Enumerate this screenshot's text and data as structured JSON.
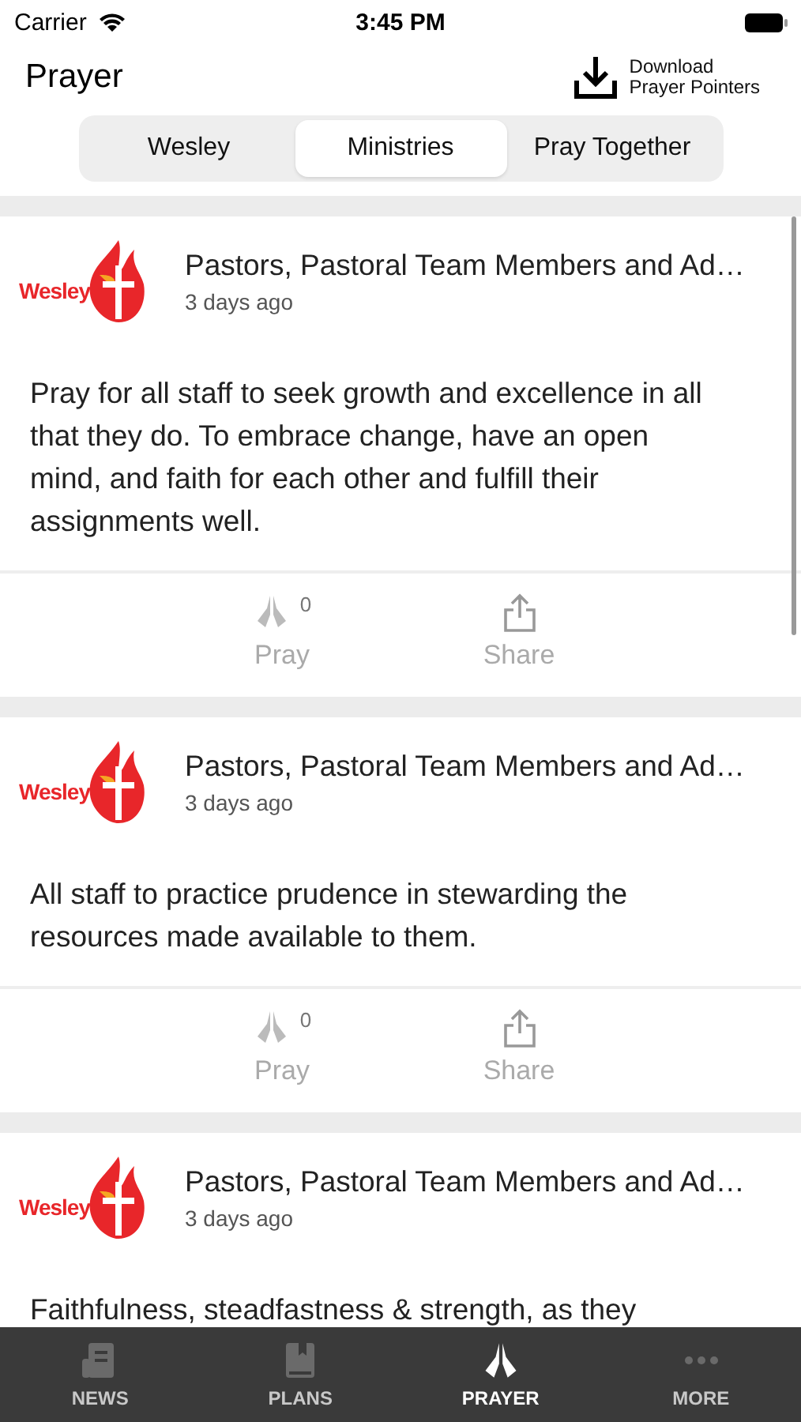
{
  "status_bar": {
    "carrier": "Carrier",
    "time": "3:45 PM"
  },
  "header": {
    "title": "Prayer",
    "download": {
      "line1": "Download",
      "line2": "Prayer Pointers"
    }
  },
  "tabs": [
    {
      "label": "Wesley",
      "selected": false
    },
    {
      "label": "Ministries",
      "selected": true
    },
    {
      "label": "Pray Together",
      "selected": false
    }
  ],
  "posts": [
    {
      "logo_text": "Wesley",
      "title": "Pastors, Pastoral Team Members and Ad…",
      "time": "3 days ago",
      "body": "Pray for all staff to seek growth and excellence in all that they do. To embrace change, have an open mind, and faith for each other and fulfill their assignments well.",
      "pray_count": "0",
      "pray_label": "Pray",
      "share_label": "Share"
    },
    {
      "logo_text": "Wesley",
      "title": "Pastors, Pastoral Team Members and Ad…",
      "time": "3 days ago",
      "body": "All staff to practice prudence in stewarding the resources made available to them.",
      "pray_count": "0",
      "pray_label": "Pray",
      "share_label": "Share"
    },
    {
      "logo_text": "Wesley",
      "title": "Pastors, Pastoral Team Members and Ad…",
      "time": "3 days ago",
      "body": "Faithfulness, steadfastness & strength, as they"
    }
  ],
  "tab_bar": [
    {
      "kind": "news",
      "label": "NEWS",
      "selected": false
    },
    {
      "kind": "plans",
      "label": "PLANS",
      "selected": false
    },
    {
      "kind": "prayer",
      "label": "PRAYER",
      "selected": true
    },
    {
      "kind": "more",
      "label": "MORE",
      "selected": false
    }
  ]
}
